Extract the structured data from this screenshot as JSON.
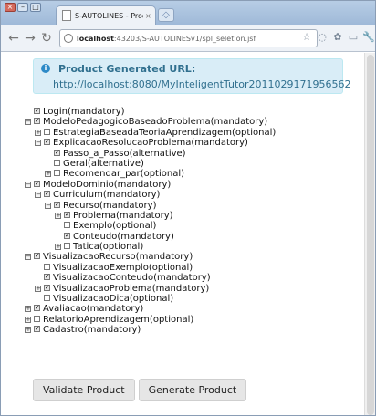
{
  "browser": {
    "tab_title": "S-AUTOLINES - Product ...",
    "url_host": "localhost",
    "url_path": ":43203/S-AUTOLINESv1/spl_seletion.jsf"
  },
  "alert": {
    "title": "Product Generated URL:",
    "url": "http://localhost:8080/MyInteligentTutor2011029171956562"
  },
  "tree": [
    {
      "label": "Login(mandatory)",
      "depth": 0,
      "exp": "",
      "checked": true
    },
    {
      "label": "ModeloPedagogicoBaseadoProblema(mandatory)",
      "depth": 0,
      "exp": "−",
      "checked": true
    },
    {
      "label": "EstrategiaBaseadaTeoriaAprendizagem(optional)",
      "depth": 1,
      "exp": "+",
      "checked": false
    },
    {
      "label": "ExplicacaoResolucaoProblema(mandatory)",
      "depth": 1,
      "exp": "−",
      "checked": true
    },
    {
      "label": "Passo_a_Passo(alternative)",
      "depth": 2,
      "exp": "",
      "checked": true
    },
    {
      "label": "Geral(alternative)",
      "depth": 2,
      "exp": "",
      "checked": false
    },
    {
      "label": "Recomendar_par(optional)",
      "depth": 2,
      "exp": "+",
      "checked": false
    },
    {
      "label": "ModeloDominio(mandatory)",
      "depth": 0,
      "exp": "−",
      "checked": true
    },
    {
      "label": "Curriculum(mandatory)",
      "depth": 1,
      "exp": "−",
      "checked": true
    },
    {
      "label": "Recurso(mandatory)",
      "depth": 2,
      "exp": "−",
      "checked": true
    },
    {
      "label": "Problema(mandatory)",
      "depth": 3,
      "exp": "+",
      "checked": true
    },
    {
      "label": "Exemplo(optional)",
      "depth": 3,
      "exp": "",
      "checked": false
    },
    {
      "label": "Conteudo(mandatory)",
      "depth": 3,
      "exp": "",
      "checked": true
    },
    {
      "label": "Tatica(optional)",
      "depth": 3,
      "exp": "+",
      "checked": false
    },
    {
      "label": "VisualizacaoRecurso(mandatory)",
      "depth": 0,
      "exp": "−",
      "checked": true
    },
    {
      "label": "VisualizacaoExemplo(optional)",
      "depth": 1,
      "exp": "",
      "checked": false
    },
    {
      "label": "VisualizacaoConteudo(mandatory)",
      "depth": 1,
      "exp": "",
      "checked": true
    },
    {
      "label": "VisualizacaoProblema(mandatory)",
      "depth": 1,
      "exp": "+",
      "checked": true
    },
    {
      "label": "VisualizacaoDica(optional)",
      "depth": 1,
      "exp": "",
      "checked": false
    },
    {
      "label": "Avaliacao(mandatory)",
      "depth": 0,
      "exp": "+",
      "checked": true
    },
    {
      "label": "RelatorioAprendizagem(optional)",
      "depth": 0,
      "exp": "+",
      "checked": false
    },
    {
      "label": "Cadastro(mandatory)",
      "depth": 0,
      "exp": "+",
      "checked": true
    }
  ],
  "buttons": {
    "validate": "Validate Product",
    "generate": "Generate Product"
  },
  "colors": {
    "alert_bg": "#d9edf7",
    "alert_text": "#31708f"
  }
}
